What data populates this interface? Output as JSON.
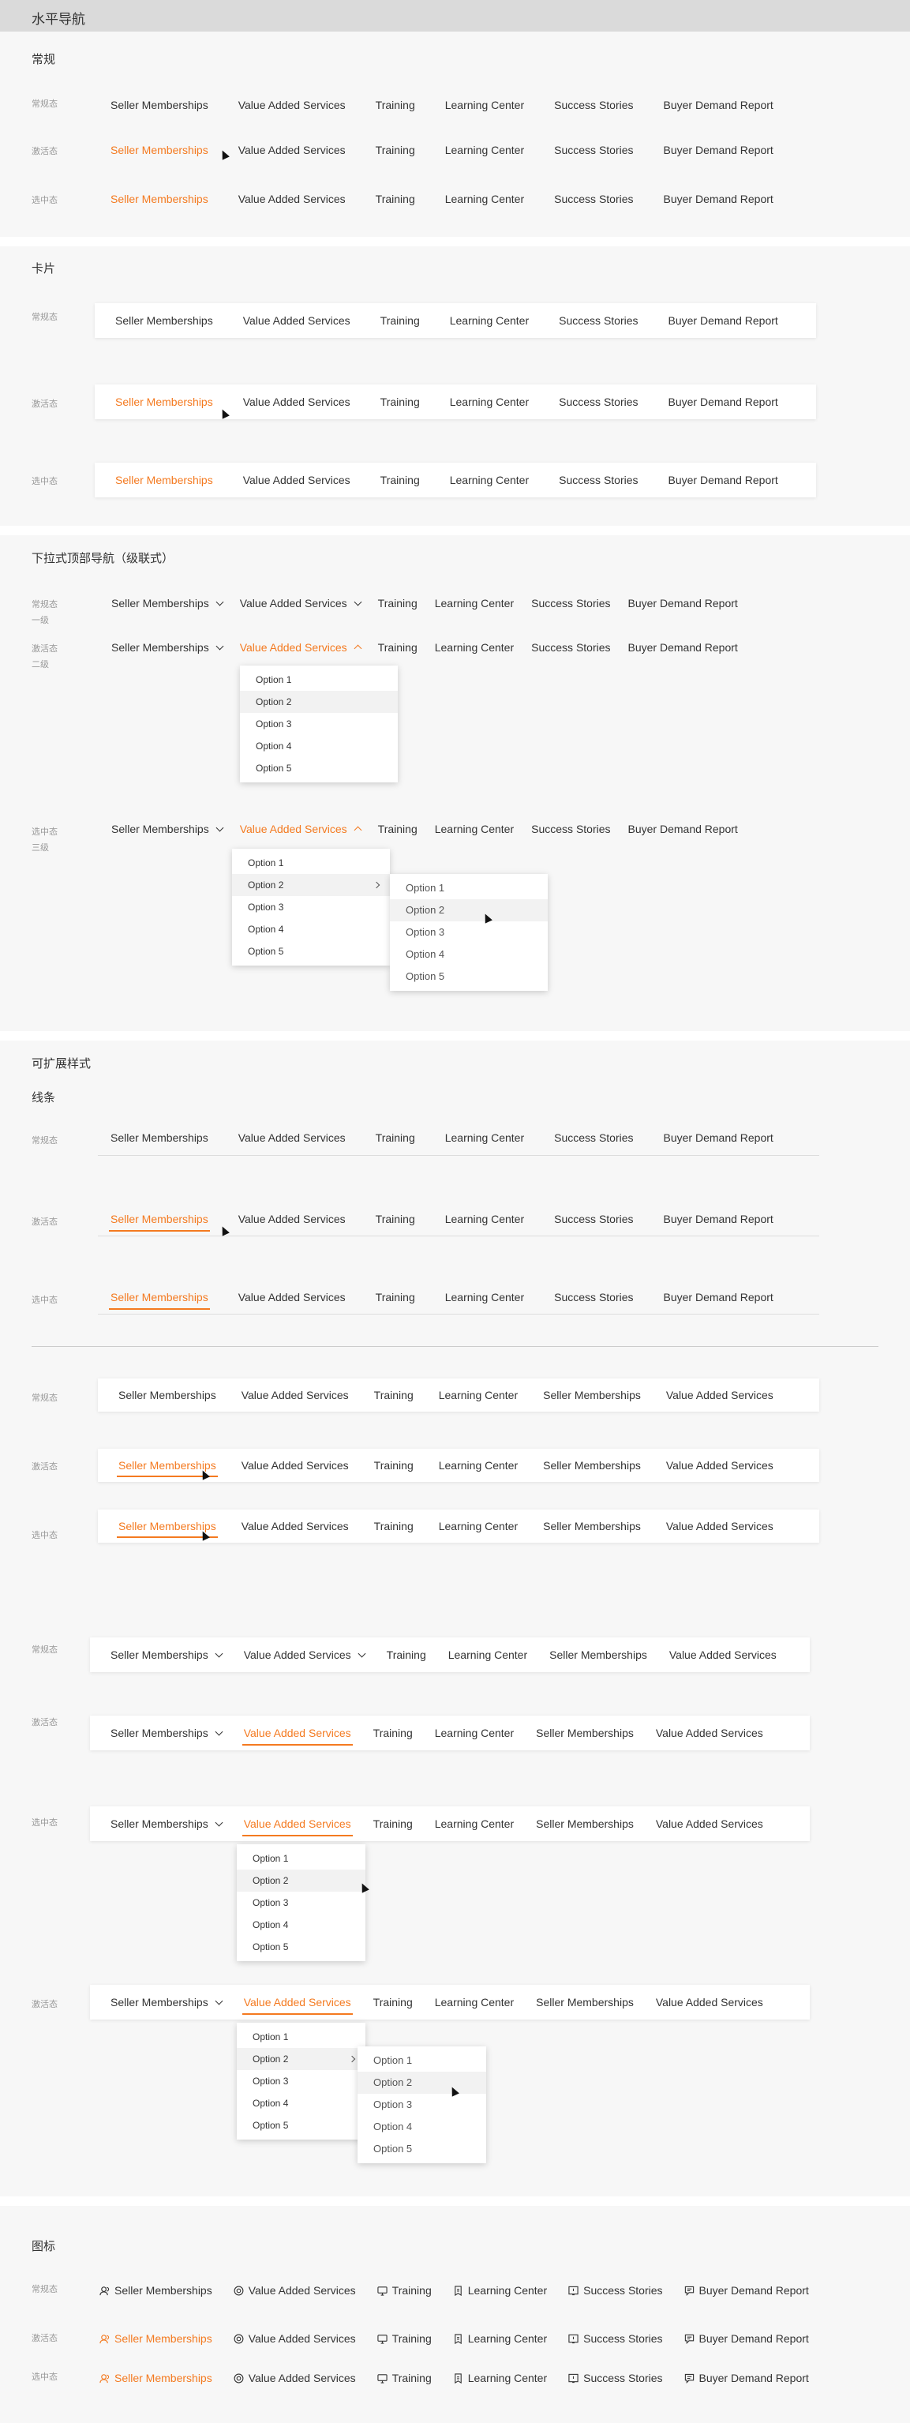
{
  "page_title": "水平导航",
  "nav_items": [
    "Seller Memberships",
    "Value Added Services",
    "Training",
    "Learning Center",
    "Success Stories",
    "Buyer Demand Report"
  ],
  "nav_items_alt": [
    "Seller Memberships",
    "Value Added Services",
    "Training",
    "Learning Center",
    "Seller Memberships",
    "Value Added Services"
  ],
  "options": [
    "Option 1",
    "Option 2",
    "Option 3",
    "Option 4",
    "Option 5"
  ],
  "labels": {
    "normal": "常规态",
    "hover": "激活态",
    "selected": "选中态",
    "normal_l1": "常规态",
    "level1": "一级",
    "hover_l2": "激活态",
    "level2": "二级",
    "selected_l3": "选中态",
    "level3": "三级"
  },
  "sections": {
    "regular": "常规",
    "card": "卡片",
    "dropdown": "下拉式顶部导航（级联式）",
    "extensible": "可扩展样式",
    "line": "线条",
    "icon": "图标"
  },
  "colors": {
    "accent": "#f47a20",
    "text": "#333333",
    "muted": "#999999"
  },
  "icons": [
    "user-icon",
    "badge-icon",
    "monitor-icon",
    "book-icon",
    "star-icon",
    "report-icon"
  ]
}
